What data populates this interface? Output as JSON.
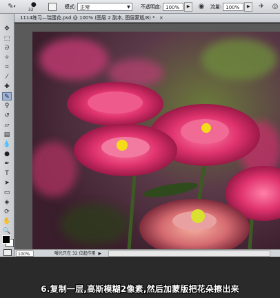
{
  "options_bar": {
    "brush_size": "32",
    "mode_label": "模式:",
    "mode_value": "正常",
    "opacity_label": "不透明度:",
    "opacity_value": "100%",
    "flow_label": "流量:",
    "flow_value": "100%"
  },
  "document": {
    "tab_title": "1114练习—瑞蛋花.psd @ 100% (图层 2 副本, 图层蒙版/8) *",
    "close": "×"
  },
  "status_bar": {
    "zoom": "100%",
    "message": "曝光只在 32 位起作用"
  },
  "caption": {
    "text": "6.复制一层,高斯模糊2像素,然后加蒙版把花朵擦出来"
  },
  "colors": {
    "foreground": "#000000",
    "background": "#ffffff",
    "flower_pink": "#e0336e",
    "flower_center": "#f5dc1a"
  }
}
